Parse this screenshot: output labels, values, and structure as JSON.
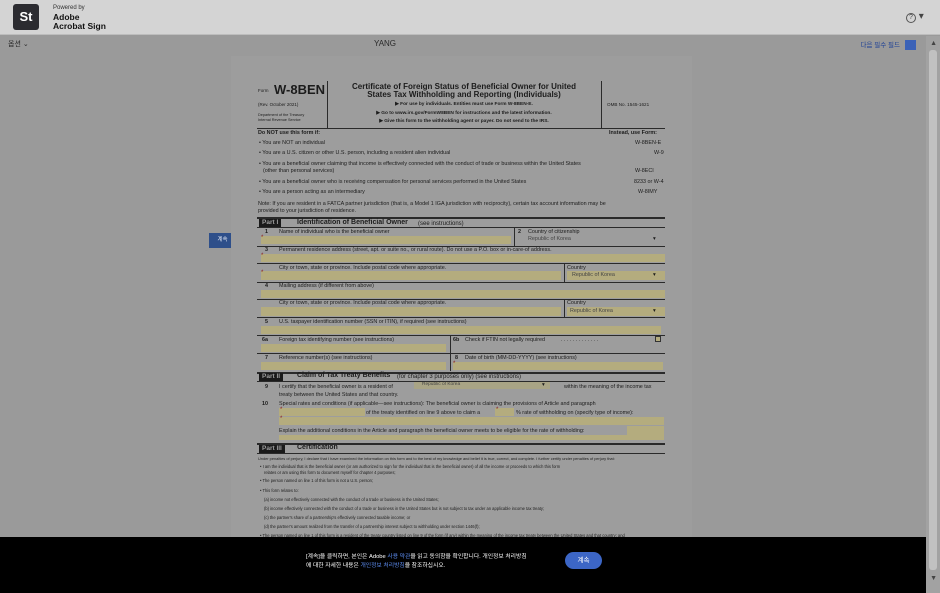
{
  "header": {
    "logo": "St",
    "powered_by": "Powered by",
    "brand_line1": "Adobe",
    "brand_line2": "Acrobat Sign",
    "help_icon": "?"
  },
  "toolbar": {
    "options_label": "옵션",
    "document_name": "YANG",
    "next_required_label": "다음 필수 필드"
  },
  "sidebar_tab": {
    "label": "계속"
  },
  "form": {
    "form_label": "Form",
    "form_number": "W-8BEN",
    "rev": "(Rev. October 2021)",
    "dept1": "Department of the Treasury",
    "dept2": "Internal Revenue Service",
    "title1": "Certificate of Foreign Status of Beneficial Owner for United",
    "title2": "States Tax Withholding and Reporting (Individuals)",
    "instr1": "▶ For use by individuals. Entities must use Form W-8BEN-E.",
    "instr2": "▶ Go to www.irs.gov/FormW8BEN for instructions and the latest information.",
    "instr3": "▶ Give this form to the withholding agent or payer. Do not send to the IRS.",
    "omb": "OMB No. 1545-1621",
    "do_not_use": "Do NOT use this form if:",
    "instead_use": "Instead, use Form:",
    "bullets": [
      {
        "text": "• You are NOT an individual",
        "form": "W-8BEN-E"
      },
      {
        "text": "• You are a U.S. citizen or other U.S. person, including a resident alien individual",
        "form": "W-9"
      },
      {
        "text": "• You are a beneficial owner claiming that income is effectively connected with the conduct of trade or business within the United States",
        "form": ""
      },
      {
        "text": "(other than personal services)",
        "form": "W-8ECI"
      },
      {
        "text": "• You are a beneficial owner who is receiving compensation for personal services performed in the United States",
        "form": "8233 or W-4"
      },
      {
        "text": "• You are a person acting as an intermediary",
        "form": "W-8IMY"
      }
    ],
    "note1": "Note: If you are resident in a FATCA partner jurisdiction (that is, a Model 1 IGA jurisdiction with reciprocity), certain tax account information may be",
    "note2": "provided to your jurisdiction of residence.",
    "part1_label": "Part I",
    "part1_title": "Identification of Beneficial Owner",
    "part1_suffix": "(see instructions)",
    "l1": "Name of individual who is the beneficial owner",
    "l2": "Country of citizenship",
    "l2_value": "Republic of Korea",
    "l3": "Permanent residence address (street, apt. or suite no., or rural route). Do not use a P.O. box or in-care-of address.",
    "l3_city": "City or town, state or province. Include postal code where appropriate.",
    "country_label": "Country",
    "country_value": "Republic of Korea",
    "l4": "Mailing address (if different from above)",
    "l4_city": "City or town, state or province. Include postal code where appropriate.",
    "country2_label": "Country",
    "country2_value": "Republic of Korea",
    "l5": "U.S. taxpayer identification number (SSN or ITIN), if required (see instructions)",
    "l6a": "Foreign tax identifying number (see instructions)",
    "l6b": "Check if FTIN not legally required",
    "l7": "Reference number(s) (see instructions)",
    "l8": "Date of birth (MM-DD-YYYY) (see instructions)",
    "part2_label": "Part II",
    "part2_title": "Claim of Tax Treaty Benefits",
    "part2_suffix": "(for chapter 3 purposes only) (see instructions)",
    "l9a": "I certify that the beneficial owner is a resident of",
    "l9_value": "Republic of Korea",
    "l9b": "within the meaning of the income tax",
    "l9c": "treaty between the United States and that country.",
    "l10a": "Special rates and conditions (if applicable—see instructions): The beneficial owner is claiming the provisions of Article and paragraph",
    "l10b": "of the treaty identified on line 9 above to claim a",
    "l10c": "% rate of withholding on (specify type of income):",
    "l10d": "Explain the additional conditions in the Article and paragraph the beneficial owner meets to be eligible for the rate of withholding:",
    "part3_label": "Part III",
    "part3_title": "Certification",
    "cert_intro": "Under penalties of perjury, I declare that I have examined the information on this form and to the best of my knowledge and belief it is true, correct, and complete. I further certify under penalties of perjury that:",
    "cert1a": "• I am the individual that is the beneficial owner (or am authorized to sign for the individual that is the beneficial owner) of all the income or proceeds to which this form",
    "cert1b": "relates or am using this form to document myself for chapter 4 purposes;",
    "cert2": "• The person named on line 1 of this form is not a U.S. person;",
    "cert3": "• This form relates to:",
    "cert3a": "(a) income not effectively connected with the conduct of a trade or business in the United States;",
    "cert3b": "(b) income effectively connected with the conduct of a trade or business in the United States but is not subject to tax under an applicable income tax treaty;",
    "cert3c": "(c) the partner's share of a partnership's effectively connected taxable income; or",
    "cert3d": "(d) the partner's amount realized from the transfer of a partnership interest subject to withholding under section 1446(f);",
    "cert4": "• The person named on line 1 of this form is a resident of the treaty country listed on line 9 of the form (if any) within the meaning of the income tax treaty between the United States and that country; and"
  },
  "consent": {
    "part1": "[계속]을 클릭하면, 본인은 Adobe ",
    "link1": "사용 약관",
    "part2": "을 읽고 동의함을 확인합니다. 개인정보 처리방침",
    "part3": "에 대한 자세한 내용은 ",
    "link2": "개인정보 처리방침",
    "part4": "을 참조하십시오.",
    "button": "계속"
  }
}
